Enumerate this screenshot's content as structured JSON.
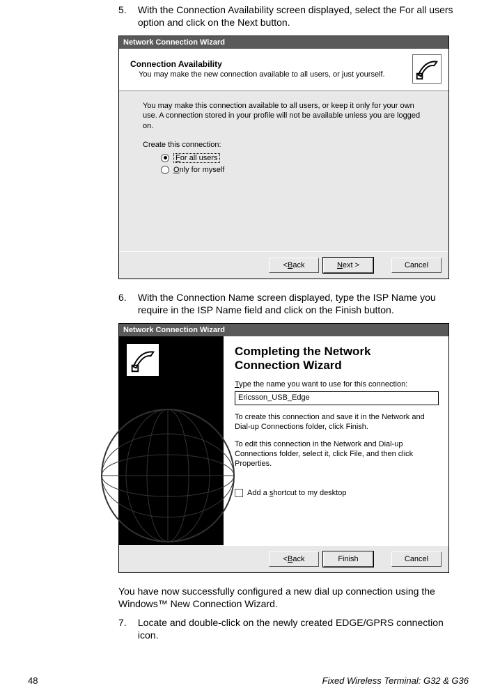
{
  "steps": {
    "s5": {
      "num": "5.",
      "text": "With the Connection Availability screen displayed, select the For all users option and click on the Next button."
    },
    "s6": {
      "num": "6.",
      "text": "With the Connection Name screen displayed, type the ISP Name you require in the ISP Name field and click on the Finish button."
    },
    "s7": {
      "num": "7.",
      "text": "Locate and double-click on the newly created EDGE/GPRS connection icon."
    }
  },
  "success_text": "You have now successfully configured a new dial up connection using the Windows™ New Connection Wizard.",
  "wizard1": {
    "title": "Network Connection Wizard",
    "header_title": "Connection Availability",
    "header_sub": "You may make the new connection available to all users, or just yourself.",
    "desc": "You may make this connection available to all users, or keep it only for your own use. A connection stored in your profile will not be available unless you are logged on.",
    "create_label": "Create this connection:",
    "radio1": "For all users",
    "radio2": "Only for myself",
    "buttons": {
      "back": "< Back",
      "next": "Next >",
      "cancel": "Cancel"
    }
  },
  "wizard2": {
    "title": "Network Connection Wizard",
    "heading": "Completing the Network Connection Wizard",
    "name_label": "Type the name you want to use for this connection:",
    "name_value": "Ericsson_USB_Edge",
    "para1": "To create this connection and save it in the Network and Dial-up Connections folder, click Finish.",
    "para2": "To edit this connection in the Network and Dial-up Connections folder, select it, click File, and then click Properties.",
    "checkbox": "Add a shortcut to my desktop",
    "buttons": {
      "back": "< Back",
      "finish": "Finish",
      "cancel": "Cancel"
    }
  },
  "footer": {
    "page": "48",
    "title": "Fixed Wireless Terminal: G32 & G36"
  }
}
